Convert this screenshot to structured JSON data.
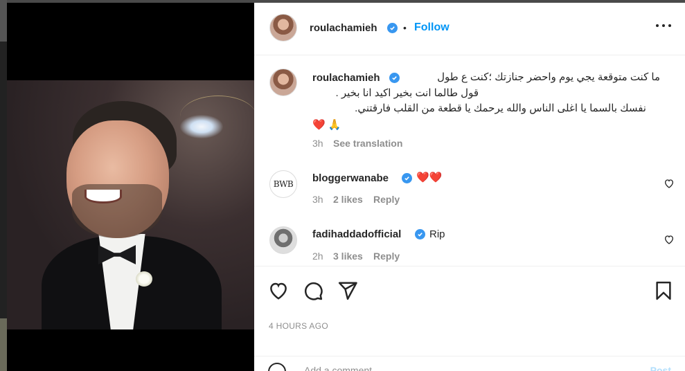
{
  "post": {
    "author": "roulachamieh",
    "separator": "•",
    "follow_label": "Follow"
  },
  "caption": {
    "username": "roulachamieh",
    "lines": [
      "ما كنت متوقعة يجي يوم واحضر جنازتك ؛كنت ع طول",
      "قول طالما انت بخير اكيد انا بخير .",
      "نفسك بالسما يا اغلى الناس والله يرحمك يا قطعة من القلب فارقتني."
    ],
    "emoji": "❤️ 🙏",
    "time": "3h",
    "see_translation": "See translation"
  },
  "comments": [
    {
      "username": "bloggerwanabe",
      "avatar_text": "BWB",
      "text": "❤️❤️",
      "time": "3h",
      "likes": "2 likes",
      "reply": "Reply"
    },
    {
      "username": "fadihaddadofficial",
      "text": "Rip",
      "time": "2h",
      "likes": "3 likes",
      "reply": "Reply"
    }
  ],
  "footer": {
    "time_ago": "4 HOURS AGO",
    "add_comment_placeholder": "Add a comment…",
    "post_label": "Post"
  },
  "colors": {
    "accent": "#0095f6",
    "verified": "#3897f0",
    "text": "#262626",
    "muted": "#8e8e8e"
  },
  "icons": [
    "more-options-icon",
    "verified-icon",
    "heart-icon",
    "comment-icon",
    "share-icon",
    "bookmark-icon",
    "small-heart-icon",
    "emoji-icon"
  ]
}
